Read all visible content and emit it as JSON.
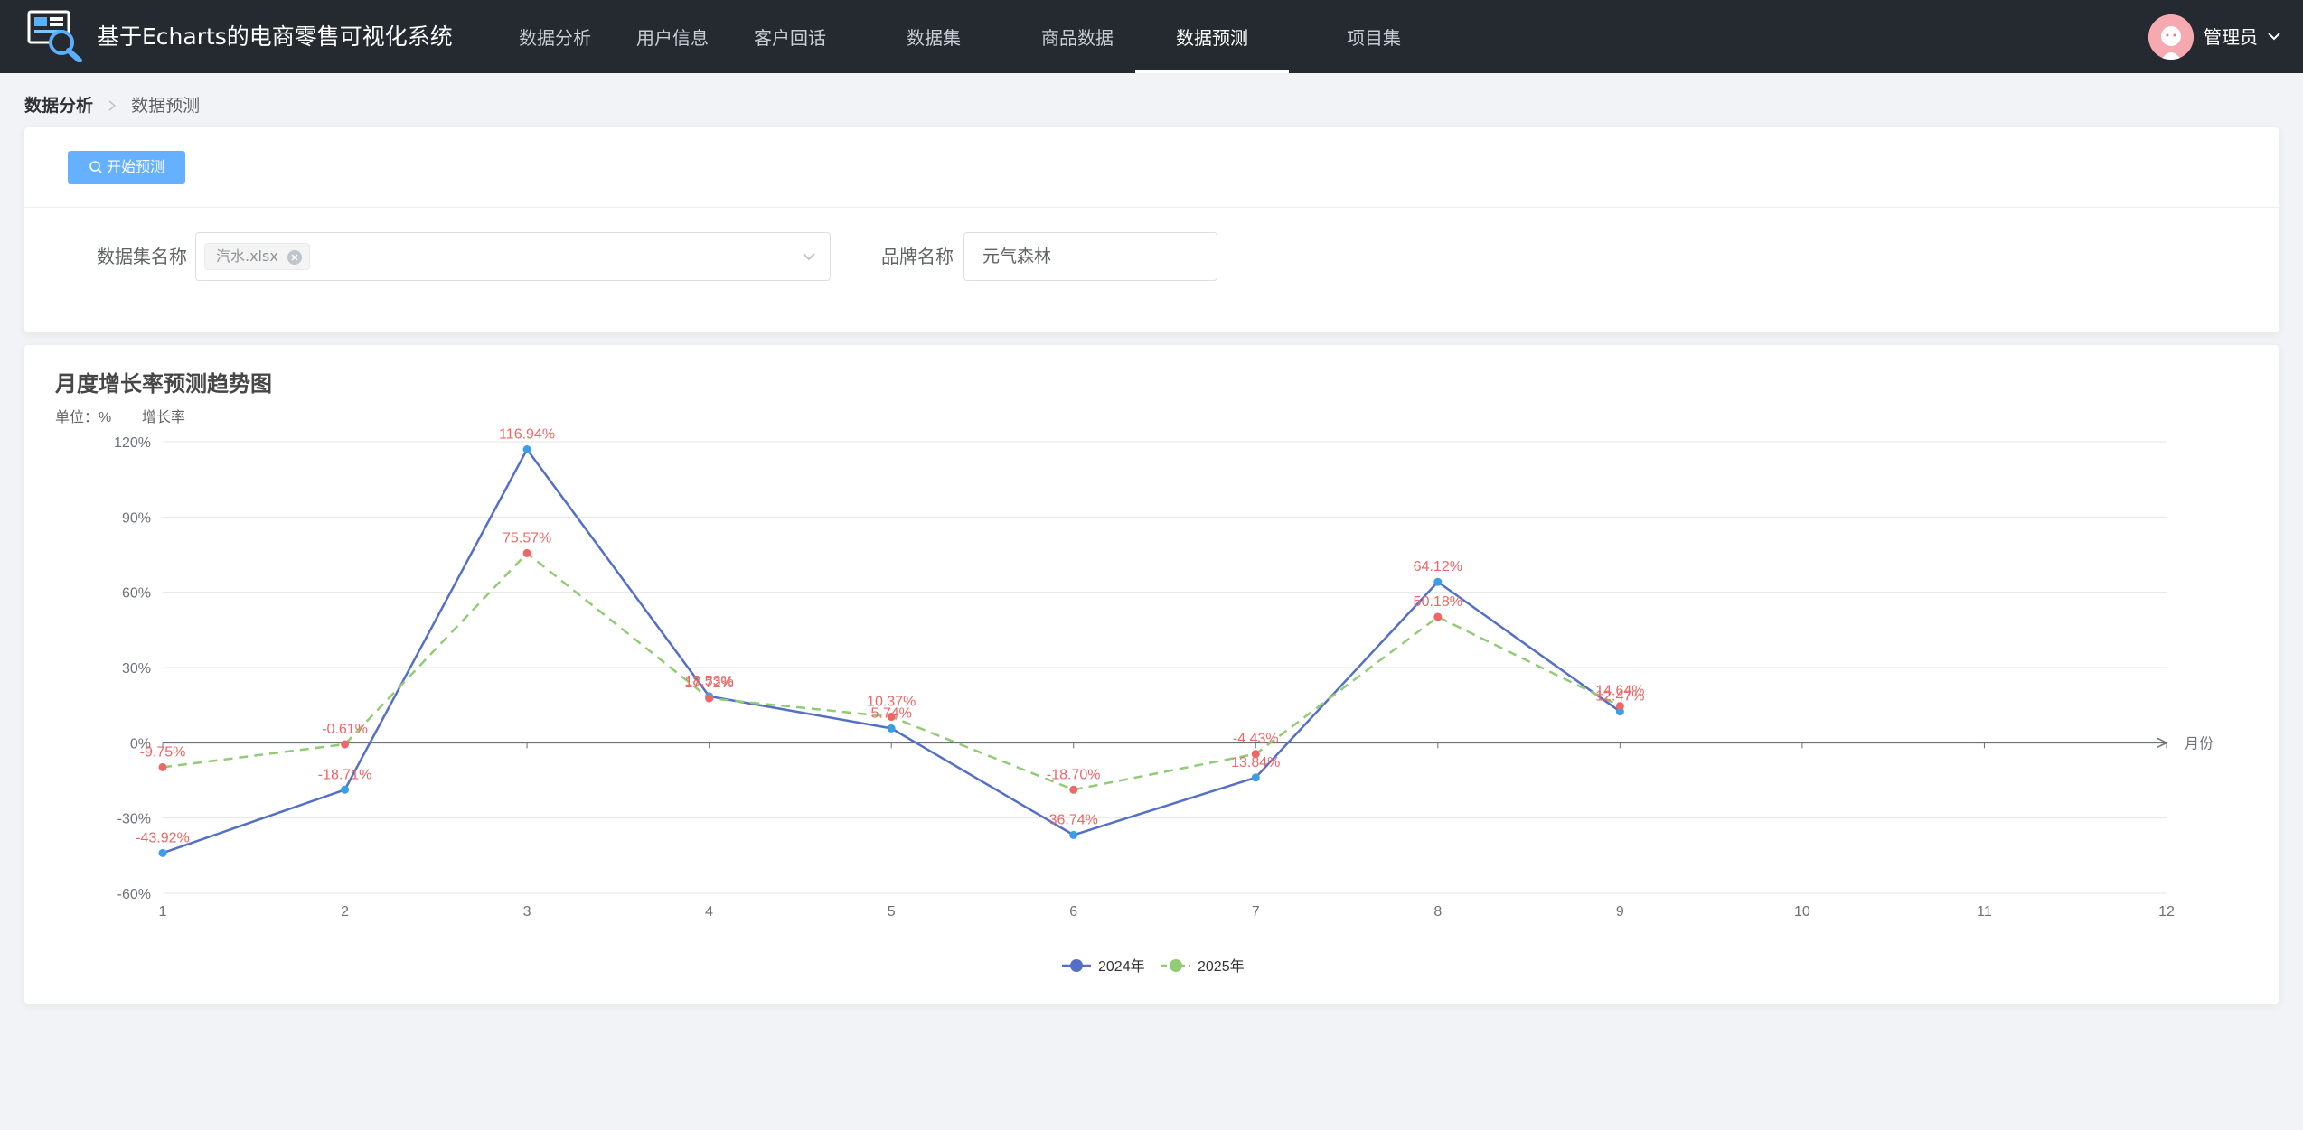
{
  "header": {
    "app_title": "基于Echarts的电商零售可视化系统",
    "nav": [
      {
        "label": "数据分析"
      },
      {
        "label": "用户信息"
      },
      {
        "label": "客户回话"
      },
      {
        "label": "数据集"
      },
      {
        "label": "商品数据"
      },
      {
        "label": "数据预测"
      },
      {
        "label": "项目集"
      }
    ],
    "active_nav": "数据预测",
    "user_name": "管理员"
  },
  "breadcrumb": {
    "parent": "数据分析",
    "current": "数据预测"
  },
  "toolbar": {
    "predict_label": "开始预测"
  },
  "form": {
    "dataset_label": "数据集名称",
    "dataset_tag": "汽水.xlsx",
    "brand_label": "品牌名称",
    "brand_value": "元气森林"
  },
  "colors": {
    "accent": "#66b1ff",
    "series_2024": "#5470c6",
    "series_2025": "#91cc75",
    "data_label": "#ee6666",
    "point_2024": "#3a9ee8"
  },
  "chart_data": {
    "type": "line",
    "title": "月度增长率预测趋势图",
    "subtitle": "单位：%",
    "ylabel": "增长率",
    "xlabel": "月份",
    "categories": [
      "1",
      "2",
      "3",
      "4",
      "5",
      "6",
      "7",
      "8",
      "9",
      "10",
      "11",
      "12"
    ],
    "ylim": [
      -60,
      120
    ],
    "yticks": [
      "-60%",
      "-30%",
      "0%",
      "30%",
      "60%",
      "90%",
      "120%"
    ],
    "grid": true,
    "legend_position": "bottom-center",
    "series": [
      {
        "name": "2024年",
        "values": [
          -43.92,
          -18.71,
          116.94,
          18.53,
          5.74,
          -36.74,
          -13.84,
          64.12,
          12.47
        ],
        "labels": [
          "-43.92%",
          "-18.71%",
          "116.94%",
          "18.53%",
          "5.74%",
          "36.74%",
          "13.84%",
          "64.12%",
          "12.47%"
        ]
      },
      {
        "name": "2025年",
        "values": [
          -9.75,
          -0.61,
          75.57,
          17.72,
          10.37,
          -18.7,
          -4.43,
          50.18,
          14.64
        ],
        "labels": [
          "-9.75%",
          "-0.61%",
          "75.57%",
          "17.72%",
          "10.37%",
          "-18.70%",
          "-4.43%",
          "50.18%",
          "14.64%"
        ]
      }
    ]
  }
}
